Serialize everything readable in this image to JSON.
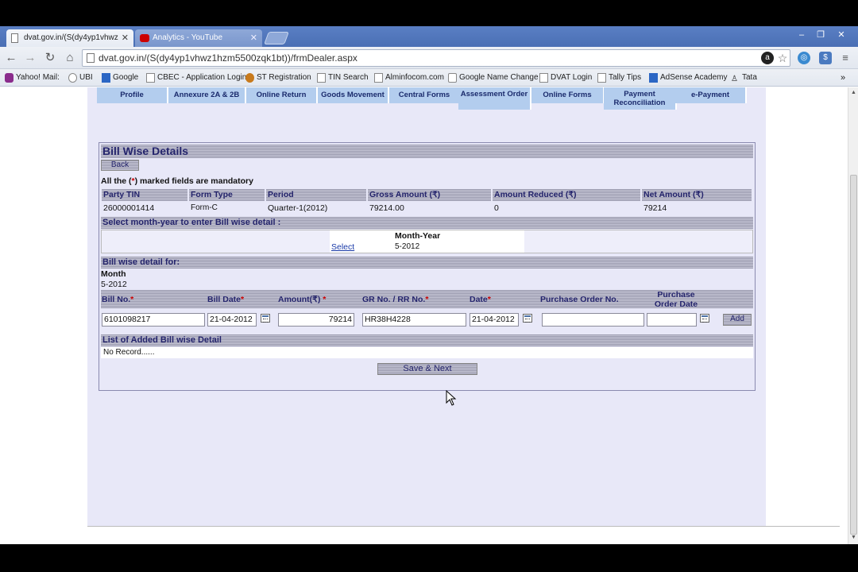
{
  "browser": {
    "tabs": [
      {
        "title": "dvat.gov.in/(S(dy4yp1vhwz",
        "active": true
      },
      {
        "title": "Analytics - YouTube",
        "active": false
      }
    ],
    "url": "dvat.gov.in/(S(dy4yp1vhwz1hzm5500zqk1bt))/frmDealer.aspx",
    "bookmarks": [
      "Yahoo! Mail:",
      "UBI",
      "Google",
      "CBEC - Application Login",
      "ST Registration",
      "TIN Search",
      "Alminfocom.com",
      "Google Name Change",
      "DVAT Login",
      "Tally Tips",
      "AdSense Academy",
      "Tata"
    ],
    "window_controls": [
      "–",
      "❐",
      "✕"
    ]
  },
  "menu": [
    "Profile",
    "Annexure 2A & 2B",
    "Online Return",
    "Goods Movement",
    "Central Forms",
    "Assessment Order",
    "Online Forms",
    "Payment Reconciliation",
    "e-Payment"
  ],
  "form": {
    "title": "Bill Wise Details",
    "back_label": "Back",
    "mandatory_note_prefix": "All the (",
    "mandatory_star": "*",
    "mandatory_note_suffix": ") marked fields are mandatory",
    "summary_headers": [
      "Party TIN",
      "Form Type",
      "Period",
      "Gross Amount (₹)",
      "Amount Reduced  (₹)",
      "Net Amount (₹)"
    ],
    "summary_row": [
      "26000001414",
      "Form-C",
      "Quarter-1(2012)",
      "79214.00",
      "0",
      "79214"
    ],
    "select_section_title": "Select month-year to enter Bill wise detail :",
    "month_year_header": "Month-Year",
    "select_link": "Select",
    "month_year_value": "5-2012",
    "detail_section_title": "Bill wise detail for:",
    "month_label": "Month",
    "month_value": "5-2012",
    "bill_headers": [
      "Bill No.",
      "Bill Date",
      "Amount(₹)",
      "GR No. / RR No.",
      "Date",
      "Purchase Order No.",
      "Purchase Order Date"
    ],
    "bill_inputs": {
      "bill_no": "6101098217",
      "bill_date": "21-04-2012",
      "amount": "79214",
      "gr_no": "HR38H4228",
      "date": "21-04-2012",
      "po_no": "",
      "po_date": ""
    },
    "add_label": "Add",
    "list_section_title": "List of Added Bill wise Detail",
    "no_record": "No Record......",
    "save_next_label": "Save & Next"
  }
}
